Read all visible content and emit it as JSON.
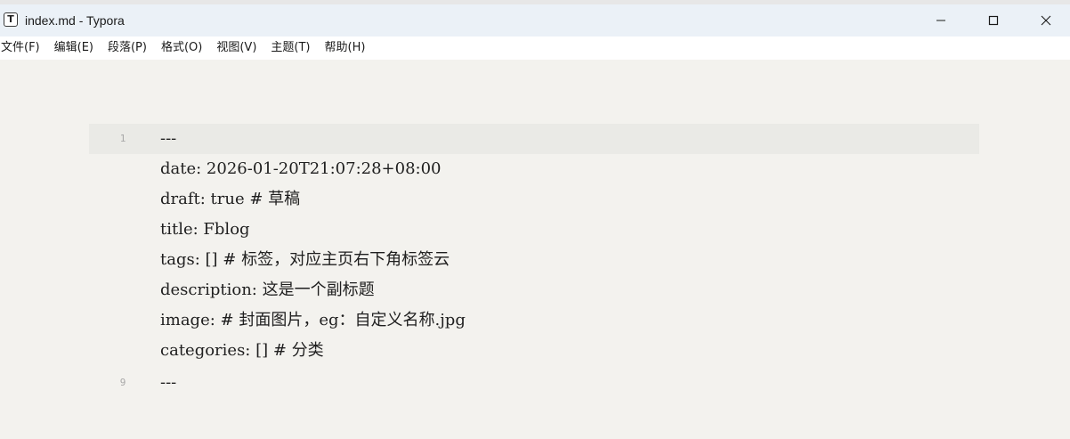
{
  "window": {
    "title": "index.md - Typora",
    "icon_letter": "T",
    "icon": "typora-app-icon",
    "controls": {
      "minimize": "minimize-icon",
      "maximize": "maximize-icon",
      "close": "close-icon"
    }
  },
  "menu": [
    "文件(F)",
    "编辑(E)",
    "段落(P)",
    "格式(O)",
    "视图(V)",
    "主题(T)",
    "帮助(H)"
  ],
  "editor": {
    "lines": [
      {
        "number": "1",
        "text": "---"
      },
      {
        "number": "",
        "text": "date: 2026-01-20T21:07:28+08:00"
      },
      {
        "number": "",
        "text": "draft: true # 草稿"
      },
      {
        "number": "",
        "text": "title: Fblog"
      },
      {
        "number": "",
        "text": "tags: [] # 标签，对应主页右下角标签云"
      },
      {
        "number": "",
        "text": "description: 这是一个副标题"
      },
      {
        "number": "",
        "text": "image: # 封面图片，eg：自定义名称.jpg"
      },
      {
        "number": "",
        "text": "categories: [] # 分类"
      },
      {
        "number": "9",
        "text": "---"
      }
    ]
  },
  "colors": {
    "titlebar_bg": "#ebf1f7",
    "editor_bg": "#f3f2ee",
    "active_line_bg": "#eaeae6",
    "text": "#1f1f1f",
    "line_number": "#a8a8a8"
  }
}
